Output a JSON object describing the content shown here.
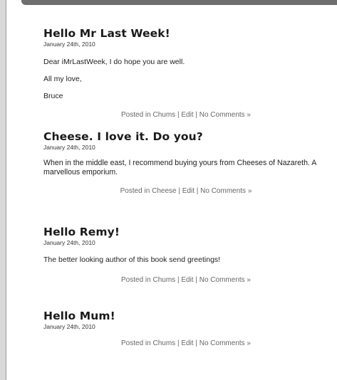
{
  "posts": [
    {
      "title": "Hello Mr Last Week!",
      "date": "January 24th, 2010",
      "paragraphs": [
        "Dear iMrLastWeek, I do hope you are well.",
        "All my love,",
        "Bruce"
      ],
      "meta": {
        "posted_in": "Posted in",
        "category": "Chums",
        "sep1": "|",
        "edit": "Edit",
        "sep2": "|",
        "comments": "No Comments »"
      }
    },
    {
      "title": "Cheese. I love it. Do you?",
      "date": "January 24th, 2010",
      "paragraphs": [
        "When in the middle east, I recommend buying yours from Cheeses of Nazareth. A marvellous emporium."
      ],
      "meta": {
        "posted_in": "Posted in",
        "category": "Cheese",
        "sep1": "|",
        "edit": "Edit",
        "sep2": "|",
        "comments": "No Comments »"
      }
    },
    {
      "title": "Hello Remy!",
      "date": "January 24th, 2010",
      "paragraphs": [
        "The better looking author of this book send greetings!"
      ],
      "meta": {
        "posted_in": "Posted in",
        "category": "Chums",
        "sep1": "|",
        "edit": "Edit",
        "sep2": "|",
        "comments": "No Comments »"
      }
    },
    {
      "title": "Hello Mum!",
      "date": "January 24th, 2010",
      "paragraphs": [],
      "meta": {
        "posted_in": "Posted in",
        "category": "Chums",
        "sep1": "|",
        "edit": "Edit",
        "sep2": "|",
        "comments": "No Comments »"
      }
    }
  ],
  "colors": {
    "title": "#1a1a1a",
    "meta": "#666666",
    "top_bar": "#6e6e6e",
    "gutter": "#d9d9d9"
  }
}
